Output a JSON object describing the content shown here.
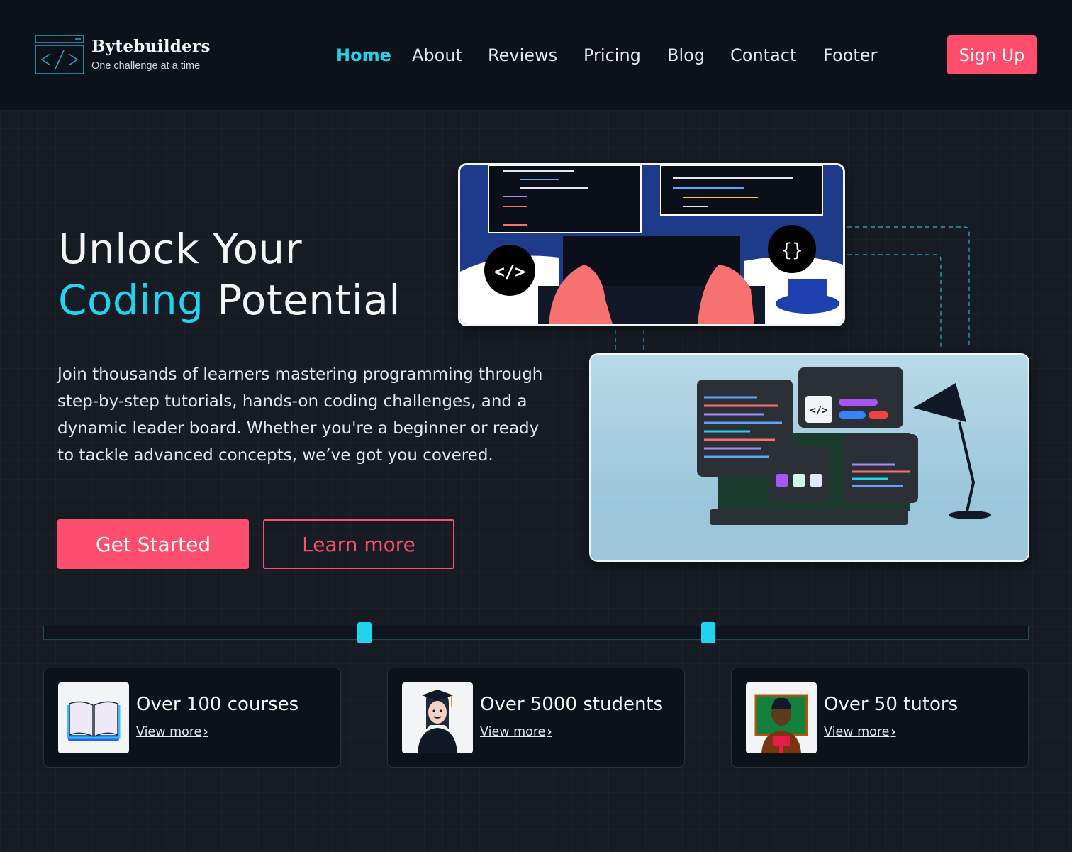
{
  "brand": {
    "name": "Bytebuilders",
    "tagline": "One challenge at a time"
  },
  "nav": {
    "items": [
      {
        "label": "Home",
        "active": true
      },
      {
        "label": "About"
      },
      {
        "label": "Reviews"
      },
      {
        "label": "Pricing"
      },
      {
        "label": "Blog"
      },
      {
        "label": "Contact"
      },
      {
        "label": "Footer"
      }
    ],
    "signup_label": "Sign Up"
  },
  "hero": {
    "title_line1": "Unlock Your",
    "title_accent": "Coding",
    "title_rest": " Potential",
    "description": "Join thousands of learners mastering programming through step-by-step tutorials, hands-on coding challenges, and a dynamic leader board. Whether you're a beginner or ready to tackle advanced concepts, we’ve got you covered.",
    "primary_cta": "Get Started",
    "secondary_cta": "Learn more"
  },
  "stats": [
    {
      "title": "Over 100 courses",
      "link": "View more",
      "icon": "open-book-icon"
    },
    {
      "title": "Over 5000 students",
      "link": "View more",
      "icon": "graduate-student-icon"
    },
    {
      "title": "Over 50 tutors",
      "link": "View more",
      "icon": "teacher-icon"
    }
  ],
  "colors": {
    "accent": "#22d3ee",
    "brand": "#ff4d6d",
    "background": "#161b24",
    "header": "#0d1119"
  }
}
